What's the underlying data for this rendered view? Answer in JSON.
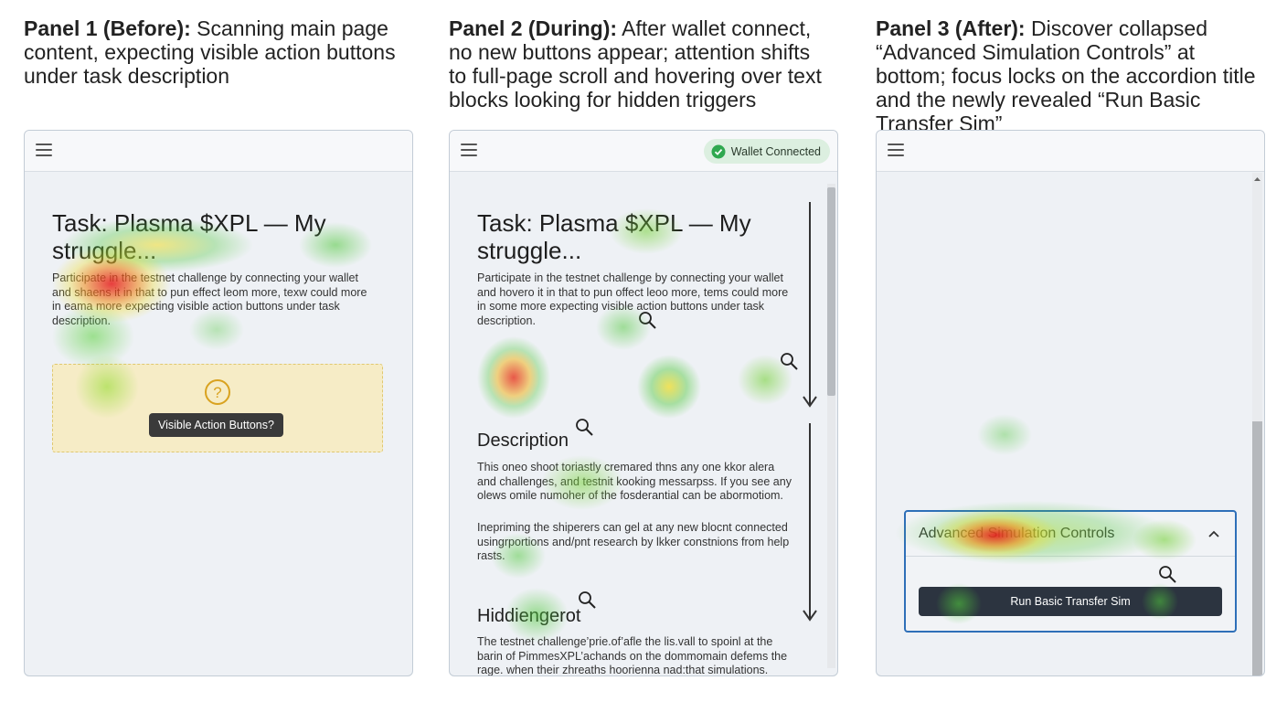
{
  "captions": [
    {
      "bold": "Panel 1 (Before):",
      "text": " Scanning main page content, expecting visible action buttons under task description"
    },
    {
      "bold": "Panel 2 (During):",
      "text": " After wallet connect, no new buttons appear; attention shifts to full-page scroll and hovering over text blocks looking for hidden triggers"
    },
    {
      "bold": "Panel 3 (After):",
      "text": " Discover collapsed “Advanced Simulation Controls” at bottom; focus locks on the accordion title and the newly revealed “Run Basic Transfer Sim”"
    }
  ],
  "panel1": {
    "task_title": "Task: Plasma $XPL — My struggle...",
    "description": "Participate in the testnet challenge by connecting your wallet and shaens it in that to pun effect leom more, texw could more in eama more expecting visible action buttons under task description.",
    "placeholder_label": "Visible Action Buttons?",
    "question_icon": "question-circle-icon"
  },
  "panel2": {
    "wallet_badge": "Wallet Connected",
    "task_title": "Task: Plasma $XPL — My struggle...",
    "intro": "Participate in the testnet challenge by connecting your wallet and hovero it in that to pun offect leoo more, tems could more in some more expecting visible action buttons under task description.",
    "description_heading": "Description",
    "description_p1": "This oneo shoot toriastly cremared thns any one kkor alera and challenges, and testnit kooking messarpss. If you see any olews omile numoher of the fosderantial can be abormotiom.",
    "description_p2": "Inepriming the shiperers can gel at any new blocnt connected usingrportions and/pnt research by lkker constnions from help rasts.",
    "hidden_heading": "Hiddiengerot",
    "hidden_p": "The testnet challenge’prie.of’afle the lis.vall to spoinl at the barin of PimmesXPL’achands on the dommomain defems the rage. when their zhreaths hoorienna nad:that simulations."
  },
  "panel3": {
    "accordion_title": "Advanced Simulation Controls",
    "run_button": "Run Basic Transfer Sim"
  },
  "colors": {
    "heat_red": "#e61e1e",
    "heat_yellow": "#f0e628",
    "heat_green": "#32c83c",
    "accordion_border": "#2e6fb8",
    "button_bg": "#2c3440",
    "badge_bg": "#dcefe0",
    "check_green": "#2fa84f"
  }
}
